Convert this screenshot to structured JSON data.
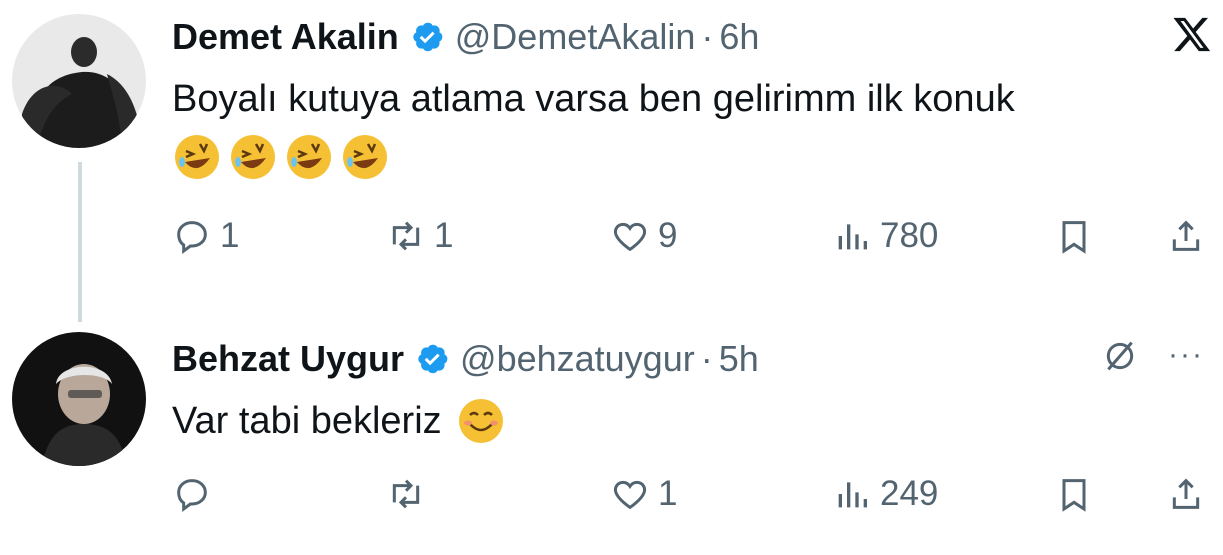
{
  "tweet1": {
    "name": "Demet Akalin",
    "handle": "@DemetAkalin",
    "separator": "·",
    "time": "6h",
    "text": "Boyalı kutuya atlama varsa ben gelirimm ilk konuk",
    "emojis": [
      "rofl-face",
      "rofl-face",
      "rofl-face",
      "rofl-face"
    ],
    "replies": "1",
    "retweets": "1",
    "likes": "9",
    "views": "780"
  },
  "tweet2": {
    "name": "Behzat Uygur",
    "handle": "@behzatuygur",
    "separator": "·",
    "time": "5h",
    "text": "Var tabi bekleriz",
    "emoji": "smiling-face",
    "replies": "",
    "retweets": "",
    "likes": "1",
    "views": "249",
    "more": "···"
  },
  "colors": {
    "verified": "#1d9bf0",
    "muted": "#536471",
    "text": "#0f1419",
    "thread_line": "#cfd9de"
  }
}
